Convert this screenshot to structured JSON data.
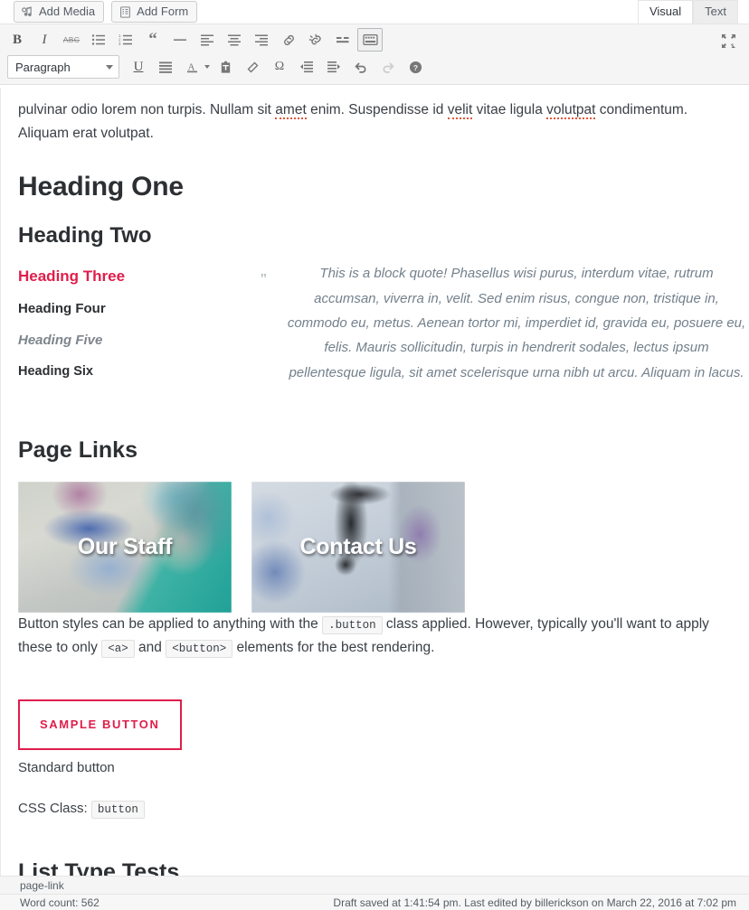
{
  "toolbar_top": {
    "add_media_label": "Add Media",
    "add_form_label": "Add Form",
    "tabs": [
      {
        "label": "Visual",
        "active": true
      },
      {
        "label": "Text",
        "active": false
      }
    ]
  },
  "format_toolbar": {
    "row1": [
      {
        "name": "bold",
        "glyph": "B"
      },
      {
        "name": "italic",
        "glyph": "I"
      },
      {
        "name": "strikethrough",
        "glyph": "ABC"
      },
      {
        "name": "bulleted-list",
        "glyph": ""
      },
      {
        "name": "numbered-list",
        "glyph": ""
      },
      {
        "name": "blockquote",
        "glyph": "“"
      },
      {
        "name": "horizontal-rule",
        "glyph": "—"
      },
      {
        "name": "align-left",
        "glyph": ""
      },
      {
        "name": "align-center",
        "glyph": ""
      },
      {
        "name": "align-right",
        "glyph": ""
      },
      {
        "name": "insert-link",
        "glyph": ""
      },
      {
        "name": "remove-link",
        "glyph": ""
      },
      {
        "name": "read-more",
        "glyph": ""
      },
      {
        "name": "toolbar-toggle",
        "glyph": "",
        "active": true
      }
    ],
    "row2": [
      {
        "name": "underline",
        "glyph": "U"
      },
      {
        "name": "justify",
        "glyph": ""
      },
      {
        "name": "text-color",
        "glyph": "A"
      },
      {
        "name": "paste-as-text",
        "glyph": ""
      },
      {
        "name": "clear-formatting",
        "glyph": ""
      },
      {
        "name": "special-character",
        "glyph": "Ω"
      },
      {
        "name": "outdent",
        "glyph": ""
      },
      {
        "name": "indent",
        "glyph": ""
      },
      {
        "name": "undo",
        "glyph": ""
      },
      {
        "name": "redo",
        "glyph": "",
        "disabled": true
      },
      {
        "name": "keyboard-shortcuts",
        "glyph": "?"
      }
    ],
    "paragraph_select_value": "Paragraph",
    "fullscreen_label": "Distraction-free writing mode"
  },
  "document": {
    "intro_paragraph_prefix": "pulvinar odio lorem non turpis. Nullam sit ",
    "intro_spell_1": "amet",
    "intro_mid_1": " enim. Suspendisse id ",
    "intro_spell_2": "velit",
    "intro_mid_2": " vitae ligula ",
    "intro_spell_3": "volutpat",
    "intro_suffix": " condimentum. Aliquam erat volutpat.",
    "heading_one": "Heading One",
    "heading_two": "Heading Two",
    "heading_three": "Heading Three",
    "heading_four": "Heading Four",
    "heading_five": "Heading Five",
    "heading_six": "Heading Six",
    "blockquote_mark": "\"",
    "blockquote_text": "This is a block quote! Phasellus wisi purus, interdum vitae, rutrum accumsan, viverra in, velit. Sed enim risus, congue non, tristique in, commodo eu, metus. Aenean tortor mi, imperdiet id, gravida eu, posuere eu, felis. Mauris sollicitudin, turpis in hendrerit sodales, lectus ipsum pellentesque ligula, sit amet scelerisque urna nibh ut arcu. Aliquam in lacus.",
    "page_links_title": "Page Links",
    "tiles": [
      {
        "label": "Our Staff"
      },
      {
        "label": "Contact Us"
      }
    ],
    "button_note_part1": "Button styles can be applied to anything with the ",
    "button_note_code1": ".button",
    "button_note_part2": " class applied. However, typically you'll want to apply these to only ",
    "button_note_code2": "<a>",
    "button_note_part3": " and ",
    "button_note_code3": "<button>",
    "button_note_part4": " elements for the best rendering.",
    "sample_button_label": "Sample Button",
    "standard_button_line": "Standard button",
    "css_class_label": "CSS Class: ",
    "css_class_value": "button",
    "list_title": "List Type Tests"
  },
  "path_bar": {
    "element_path": "page-link"
  },
  "status_bar": {
    "word_count": "Word count: 562",
    "save_status": "Draft saved at 1:41:54 pm. Last edited by billerickson on March 22, 2016 at 7:02 pm"
  },
  "colors": {
    "accent_red": "#e01d4b",
    "toolbar_bg": "#f5f5f5",
    "text": "#3a3f45",
    "muted": "#7d858c"
  }
}
